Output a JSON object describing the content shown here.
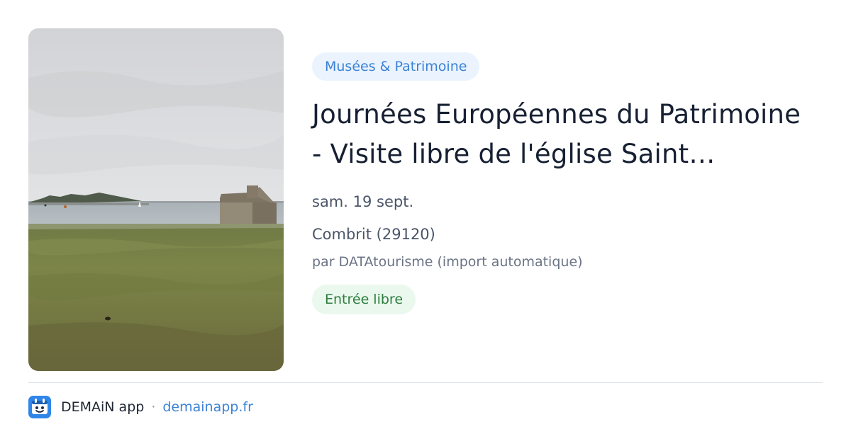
{
  "image": {
    "alt": ""
  },
  "event": {
    "category": "Musées & Patrimoine",
    "title": "Journées Européennes du Patrimoine - Visite libre de l'église Saint…",
    "date": "sam. 19 sept.",
    "location": "Combrit (29120)",
    "source": "par DATAtourisme (import automatique)",
    "price": "Entrée libre"
  },
  "footer": {
    "app_name": "DEMAiN app",
    "separator": "·",
    "domain": "demainapp.fr",
    "logo_icon": "demain-app-logo-icon"
  },
  "colors": {
    "accent": "#3b82d6",
    "category_bg": "#eaf3fe",
    "price_bg": "#eaf8ee",
    "price_text": "#2e7d3e",
    "title": "#172033"
  }
}
